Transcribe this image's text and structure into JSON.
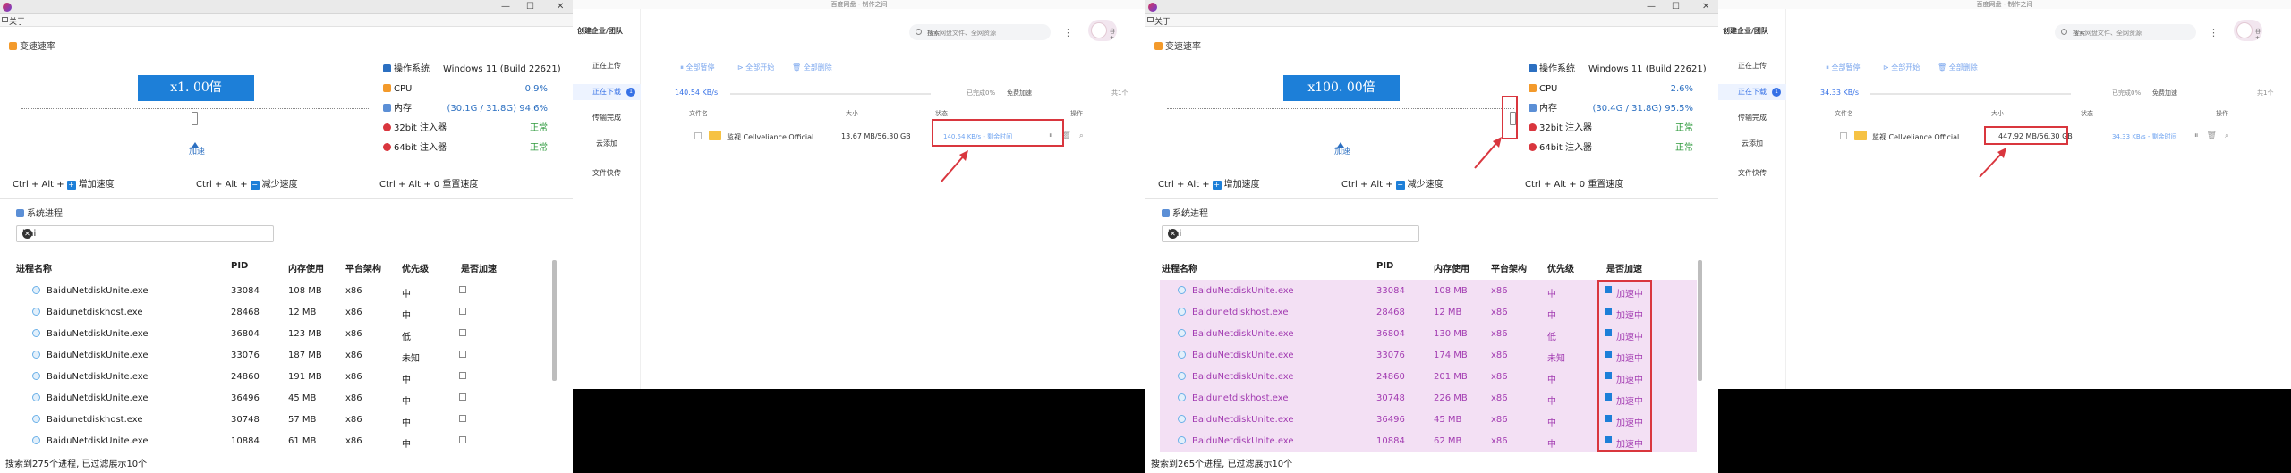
{
  "speed_tool": {
    "window_title": "关于",
    "window_controls": [
      "—",
      "☐",
      "✕"
    ],
    "group_speed": "变速速率",
    "group_process": "系统进程",
    "slider_label": "加速",
    "hotkeys": {
      "plus_prefix": "Ctrl + Alt +",
      "plus_suffix": "增加速度",
      "minus_prefix": "Ctrl + Alt +",
      "minus_suffix": "减少速度",
      "reset": "Ctrl + Alt + 0 重置速度"
    },
    "info_labels": {
      "os": "操作系统",
      "cpu": "CPU",
      "mem": "内存",
      "inj32": "32bit 注入器",
      "inj64": "64bit 注入器"
    },
    "os_value": "Windows 11 (Build 22621)",
    "search_value": "bai",
    "columns": [
      "进程名称",
      "PID",
      "内存使用",
      "平台架构",
      "优先级",
      "是否加速"
    ],
    "panels": [
      {
        "multiplier": "x1. 00倍",
        "cpu": "0.9%",
        "mem": "(30.1G / 31.8G) 94.6%",
        "inj32": "正常",
        "inj64": "正常",
        "status": "搜索到275个进程, 已过滤展示10个",
        "rows": [
          {
            "name": "BaiduNetdiskUnite.exe",
            "pid": "33084",
            "mem": "108 MB",
            "arch": "x86",
            "prio": "中",
            "accel": false,
            "label": ""
          },
          {
            "name": "Baidunetdiskhost.exe",
            "pid": "28468",
            "mem": "12 MB",
            "arch": "x86",
            "prio": "中",
            "accel": false,
            "label": ""
          },
          {
            "name": "BaiduNetdiskUnite.exe",
            "pid": "36804",
            "mem": "123 MB",
            "arch": "x86",
            "prio": "低",
            "accel": false,
            "label": ""
          },
          {
            "name": "BaiduNetdiskUnite.exe",
            "pid": "33076",
            "mem": "187 MB",
            "arch": "x86",
            "prio": "未知",
            "accel": false,
            "label": ""
          },
          {
            "name": "BaiduNetdiskUnite.exe",
            "pid": "24860",
            "mem": "191 MB",
            "arch": "x86",
            "prio": "中",
            "accel": false,
            "label": ""
          },
          {
            "name": "BaiduNetdiskUnite.exe",
            "pid": "36496",
            "mem": "45 MB",
            "arch": "x86",
            "prio": "中",
            "accel": false,
            "label": ""
          },
          {
            "name": "Baidunetdiskhost.exe",
            "pid": "30748",
            "mem": "57 MB",
            "arch": "x86",
            "prio": "中",
            "accel": false,
            "label": ""
          },
          {
            "name": "BaiduNetdiskUnite.exe",
            "pid": "10884",
            "mem": "61 MB",
            "arch": "x86",
            "prio": "中",
            "accel": false,
            "label": ""
          }
        ]
      },
      {
        "multiplier": "x100. 00倍",
        "cpu": "2.6%",
        "mem": "(30.4G / 31.8G) 95.5%",
        "inj32": "正常",
        "inj64": "正常",
        "status": "搜索到265个进程, 已过滤展示10个",
        "rows": [
          {
            "name": "BaiduNetdiskUnite.exe",
            "pid": "33084",
            "mem": "108 MB",
            "arch": "x86",
            "prio": "中",
            "accel": true,
            "label": "加速中"
          },
          {
            "name": "Baidunetdiskhost.exe",
            "pid": "28468",
            "mem": "12 MB",
            "arch": "x86",
            "prio": "中",
            "accel": true,
            "label": "加速中"
          },
          {
            "name": "BaiduNetdiskUnite.exe",
            "pid": "36804",
            "mem": "130 MB",
            "arch": "x86",
            "prio": "低",
            "accel": true,
            "label": "加速中"
          },
          {
            "name": "BaiduNetdiskUnite.exe",
            "pid": "33076",
            "mem": "174 MB",
            "arch": "x86",
            "prio": "未知",
            "accel": true,
            "label": "加速中"
          },
          {
            "name": "BaiduNetdiskUnite.exe",
            "pid": "24860",
            "mem": "201 MB",
            "arch": "x86",
            "prio": "中",
            "accel": true,
            "label": "加速中"
          },
          {
            "name": "Baidunetdiskhost.exe",
            "pid": "30748",
            "mem": "226 MB",
            "arch": "x86",
            "prio": "中",
            "accel": true,
            "label": "加速中"
          },
          {
            "name": "BaiduNetdiskUnite.exe",
            "pid": "36496",
            "mem": "45 MB",
            "arch": "x86",
            "prio": "中",
            "accel": true,
            "label": "加速中"
          },
          {
            "name": "BaiduNetdiskUnite.exe",
            "pid": "10884",
            "mem": "62 MB",
            "arch": "x86",
            "prio": "中",
            "accel": true,
            "label": "加速中"
          }
        ]
      }
    ]
  },
  "netdisk": {
    "window_title": "百度网盘 - 制作之间",
    "create_team": "创建企业/团队",
    "nav": [
      "正在上传",
      "正在下载",
      "传输完成",
      "云添加",
      "文件快传"
    ],
    "download_badge": "1",
    "search_placeholder": "搜索网盘文件、全网资源",
    "search_button": "搜索",
    "user": "谷 +",
    "toolbar": [
      "全部暂停",
      "全部开始",
      "全部删除"
    ],
    "free_speed": "免费加速",
    "count": "共1个",
    "cols": [
      "文件名",
      "大小",
      "状态",
      "操作"
    ],
    "file_name": "监视 Cellveliance Official",
    "panels": [
      {
        "total_speed": "140.54 KB/s",
        "progress_text": "已完成0%",
        "progress": 0.0,
        "file_size": "13.67 MB/56.30 GB",
        "file_status": "140.54 KB/s - 剩余时间"
      },
      {
        "total_speed": "34.33 KB/s",
        "progress_text": "已完成0%",
        "progress": 0.0,
        "file_size": "447.92 MB/56.30 GB",
        "file_status": "34.33 KB/s - 剩余时间"
      }
    ]
  }
}
